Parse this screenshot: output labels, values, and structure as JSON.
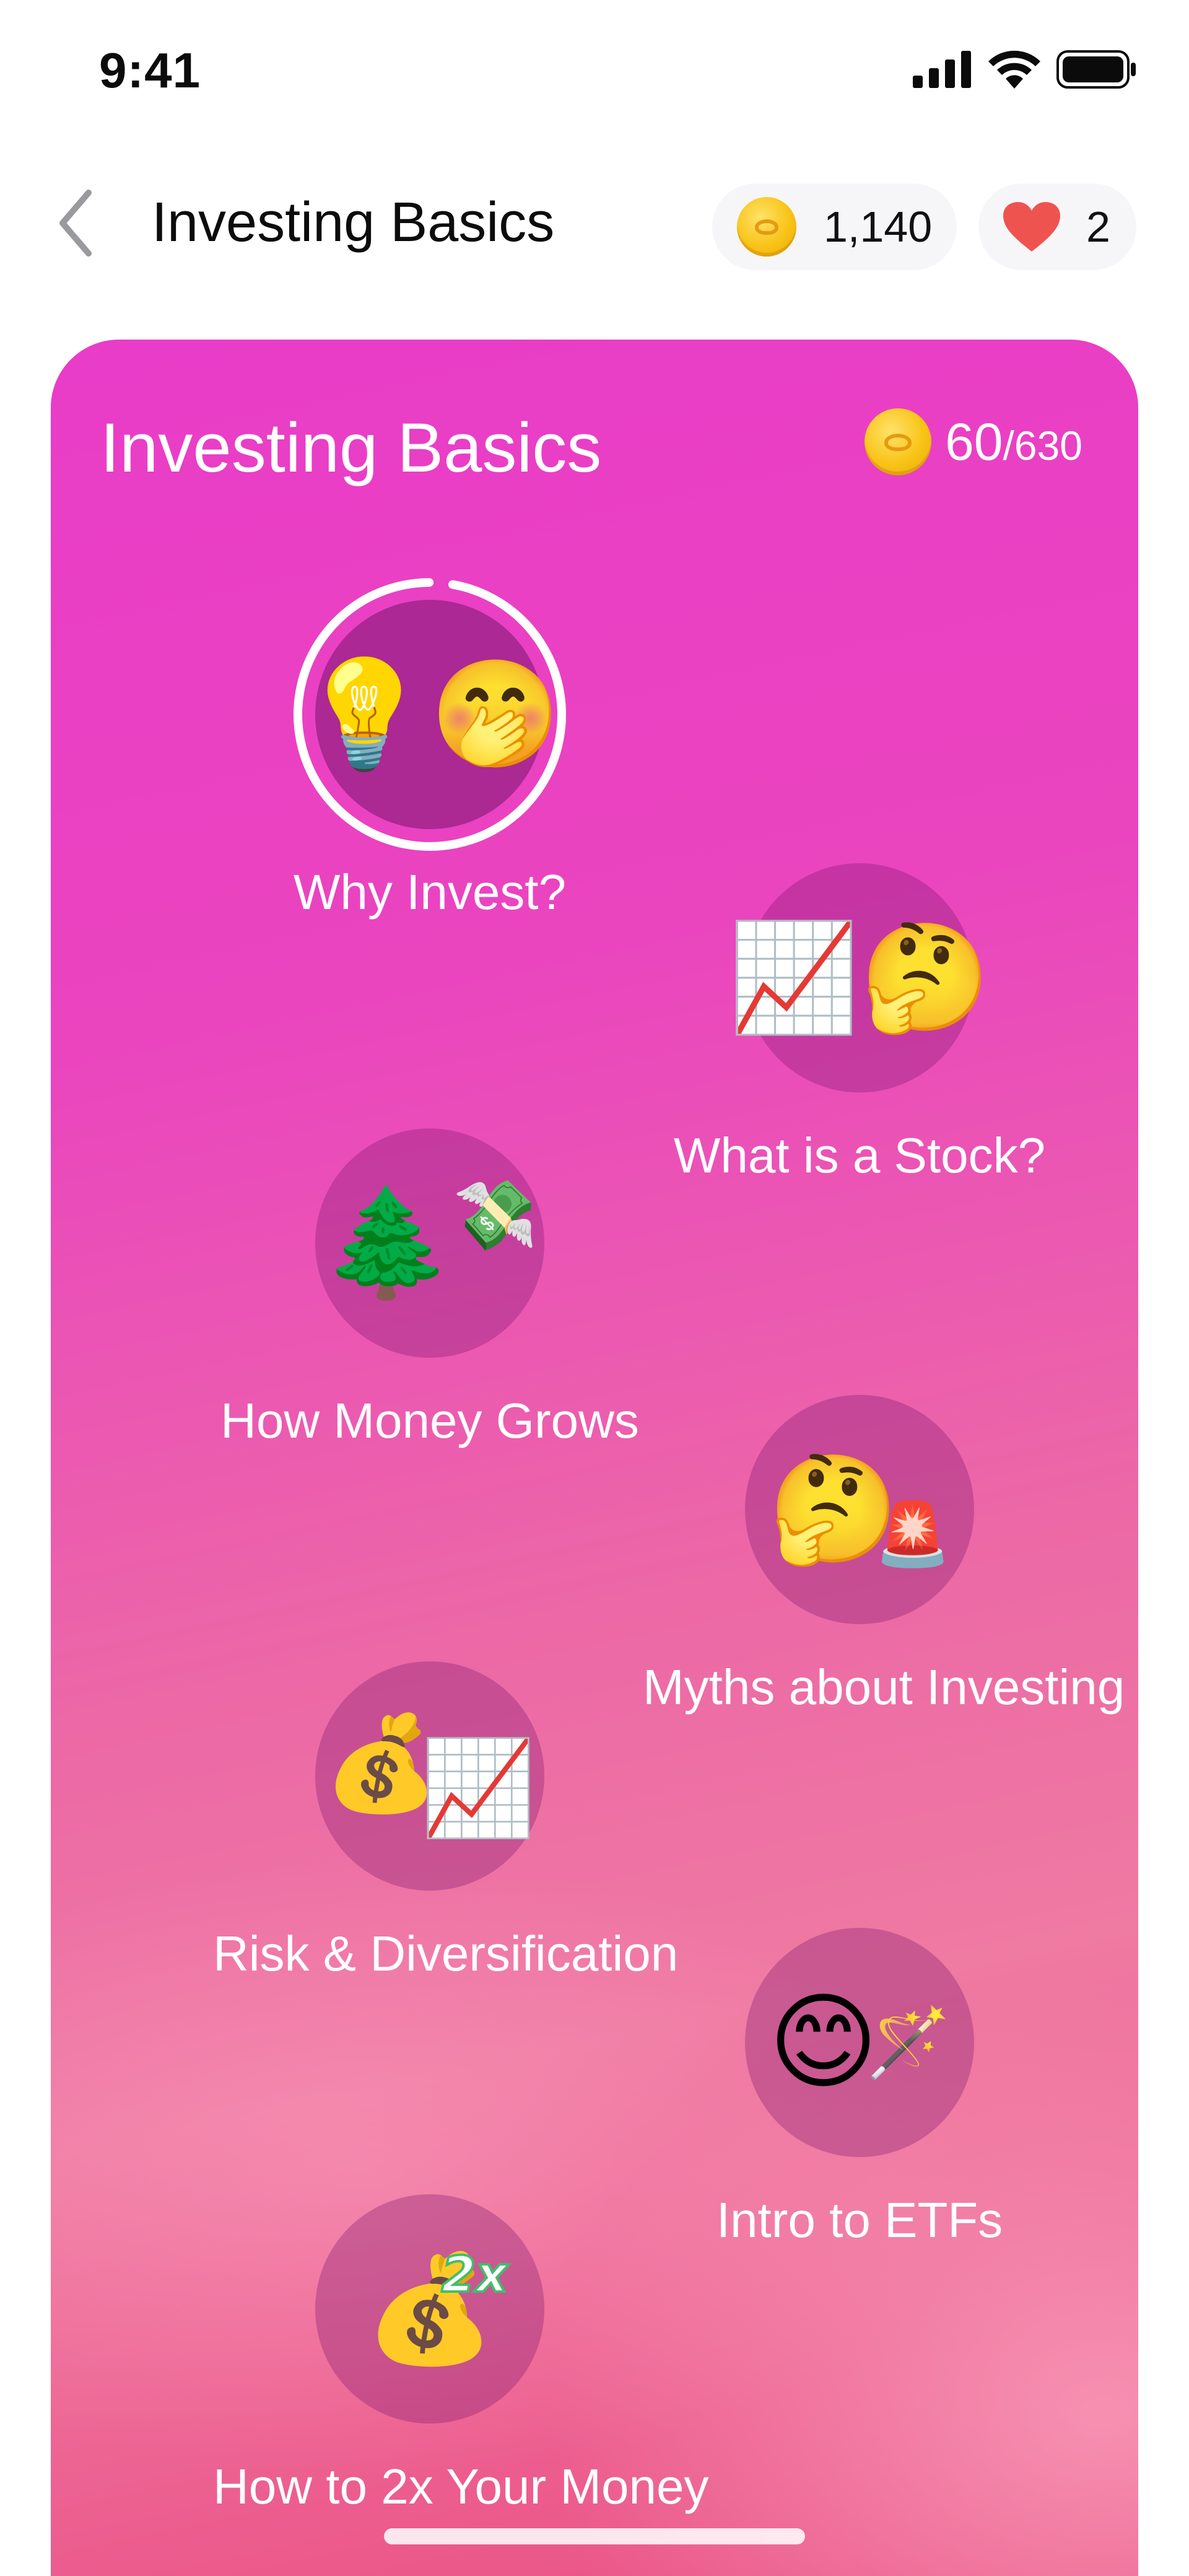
{
  "status_bar": {
    "time": "9:41",
    "icons": [
      "cellular-signal-icon",
      "wifi-icon",
      "battery-icon"
    ]
  },
  "header": {
    "back_icon": "chevron-left-icon",
    "title": "Investing Basics",
    "coins": "1,140",
    "coins_icon": "coin-icon",
    "hearts": "2",
    "hearts_icon": "heart-icon"
  },
  "course": {
    "title": "Investing Basics",
    "progress_value": "60",
    "progress_total": "/630",
    "progress_icon": "coin-icon",
    "lessons": [
      {
        "label": "Why Invest?",
        "icon": "lightbulb-thinking-memoji-icon",
        "emoji_a": "💡",
        "emoji_b": "🤭",
        "active": true
      },
      {
        "label": "What is a Stock?",
        "icon": "chart-thinking-memoji-icon",
        "emoji_a": "📈",
        "emoji_b": "🤔",
        "active": false
      },
      {
        "label": "How Money Grows",
        "icon": "tree-flying-money-icon",
        "emoji_a": "🌲",
        "emoji_b": "💸",
        "active": false
      },
      {
        "label": "Myths about Investing",
        "icon": "thinking-siren-memoji-icon",
        "emoji_a": "🤔",
        "emoji_b": "🚨",
        "active": false
      },
      {
        "label": "Risk & Diversification",
        "icon": "moneybag-chart-icon",
        "emoji_a": "💰",
        "emoji_b": "📈",
        "active": false
      },
      {
        "label": "Intro to ETFs",
        "icon": "magic-wand-memoji-icon",
        "emoji_a": "😊",
        "emoji_b": "🪄",
        "active": false
      },
      {
        "label": "How to 2x Your Money",
        "icon": "moneybag-2x-icon",
        "emoji_a": "💰",
        "emoji_b": "",
        "active": false
      }
    ]
  },
  "colors": {
    "card_top": "#e93cc8",
    "card_bottom": "#e94f82",
    "coin": "#f8c316",
    "heart": "#ef5350"
  }
}
